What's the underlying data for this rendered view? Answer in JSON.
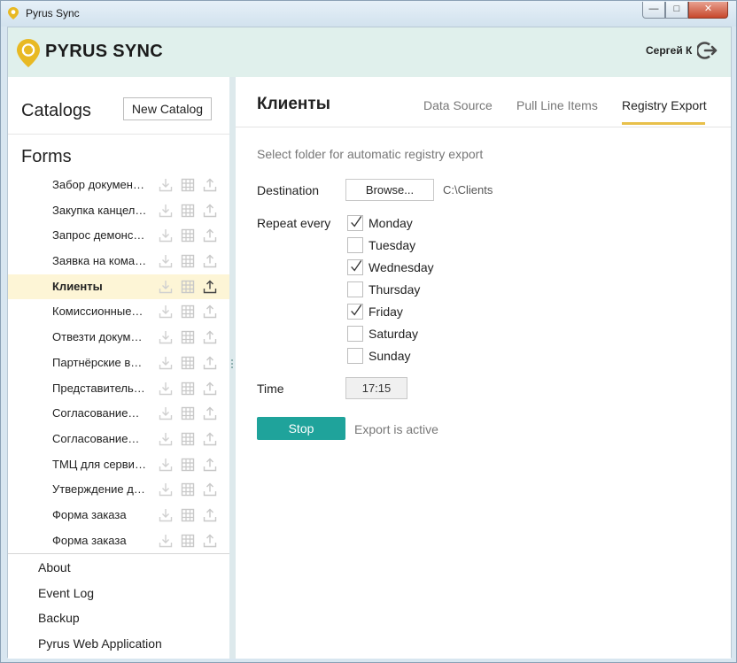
{
  "window": {
    "title": "Pyrus Sync",
    "min_label": "—",
    "max_label": "□",
    "close_label": "✕"
  },
  "header": {
    "brand": "PYRUS SYNC",
    "username": "Сергей К",
    "accent_color": "#e8b923"
  },
  "sidebar": {
    "catalogs_title": "Catalogs",
    "new_catalog_label": "New Catalog",
    "forms_title": "Forms",
    "forms": [
      {
        "label": "Забор докумен…",
        "active": false
      },
      {
        "label": "Закупка канцел…",
        "active": false
      },
      {
        "label": "Запрос демонс…",
        "active": false
      },
      {
        "label": "Заявка на кома…",
        "active": false
      },
      {
        "label": "Клиенты",
        "active": true
      },
      {
        "label": "Комиссионные…",
        "active": false
      },
      {
        "label": "Отвезти докум…",
        "active": false
      },
      {
        "label": "Партнёрские в…",
        "active": false
      },
      {
        "label": "Представитель…",
        "active": false
      },
      {
        "label": "Согласование…",
        "active": false
      },
      {
        "label": "Согласование…",
        "active": false
      },
      {
        "label": "ТМЦ для серви…",
        "active": false
      },
      {
        "label": "Утверждение д…",
        "active": false
      },
      {
        "label": "Форма заказа",
        "active": false
      },
      {
        "label": "Форма заказа",
        "active": false
      }
    ],
    "links": [
      "About",
      "Event Log",
      "Backup",
      "Pyrus Web Application"
    ]
  },
  "main": {
    "title": "Клиенты",
    "tabs": [
      {
        "label": "Data Source",
        "active": false
      },
      {
        "label": "Pull Line Items",
        "active": false
      },
      {
        "label": "Registry Export",
        "active": true
      }
    ],
    "hint": "Select folder for automatic registry export",
    "destination_label": "Destination",
    "browse_label": "Browse...",
    "destination_path": "C:\\Clients",
    "repeat_label": "Repeat every",
    "days": [
      {
        "label": "Monday",
        "checked": true
      },
      {
        "label": "Tuesday",
        "checked": false
      },
      {
        "label": "Wednesday",
        "checked": true
      },
      {
        "label": "Thursday",
        "checked": false
      },
      {
        "label": "Friday",
        "checked": true
      },
      {
        "label": "Saturday",
        "checked": false
      },
      {
        "label": "Sunday",
        "checked": false
      }
    ],
    "time_label": "Time",
    "time_value": "17:15",
    "stop_label": "Stop",
    "status": "Export is active",
    "stop_color": "#1fa39b"
  }
}
